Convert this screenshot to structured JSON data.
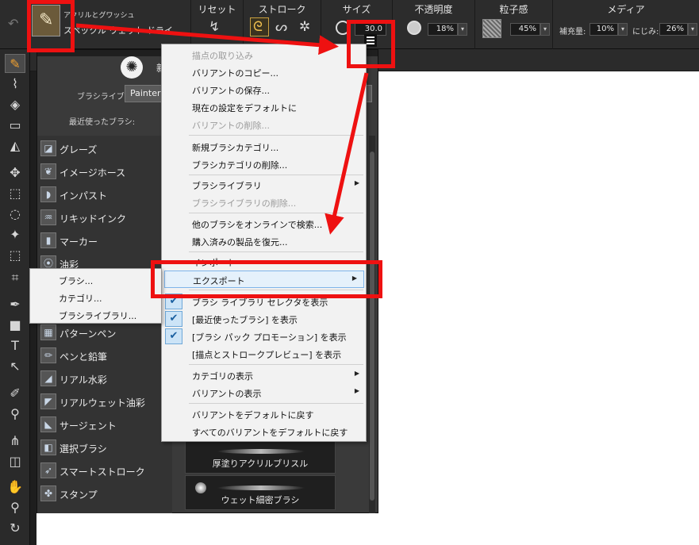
{
  "topbar": {
    "brush_category": "アクリルとグワッシュ",
    "brush_variant": "スペックル ウェット ドライ",
    "reset_label": "リセット",
    "stroke_label": "ストローク",
    "size_label": "サイズ",
    "size_value": "30.0",
    "opacity_label": "不透明度",
    "opacity_value": "18%",
    "grain_label": "粒子感",
    "grain_value": "45%",
    "media_label": "メディア",
    "resaturation_label": "補充量:",
    "resaturation_value": "10%",
    "bleed_label": "にじみ:",
    "bleed_value": "26%"
  },
  "panel": {
    "title": "新",
    "library_label": "ブラシライブラリ:",
    "library_value": "Painter",
    "recent_label": "最近使ったブラシ:",
    "categories": [
      {
        "label": "グレーズ",
        "icon": "glaze-icon"
      },
      {
        "label": "イメージホース",
        "icon": "image-hose-icon"
      },
      {
        "label": "インパスト",
        "icon": "impasto-icon"
      },
      {
        "label": "リキッドインク",
        "icon": "liquid-ink-icon"
      },
      {
        "label": "マーカー",
        "icon": "marker-icon"
      },
      {
        "label": "油彩",
        "icon": "oil-icon"
      },
      {
        "label": "",
        "icon": "blank-icon"
      },
      {
        "label": "",
        "icon": "blank-icon"
      },
      {
        "label": "パターンペン",
        "icon": "pattern-pen-icon"
      },
      {
        "label": "ペンと鉛筆",
        "icon": "pen-pencil-icon"
      },
      {
        "label": "リアル水彩",
        "icon": "real-watercolor-icon"
      },
      {
        "label": "リアルウェット油彩",
        "icon": "real-wet-oil-icon"
      },
      {
        "label": "サージェント",
        "icon": "sargent-icon"
      },
      {
        "label": "選択ブラシ",
        "icon": "selection-brush-icon"
      },
      {
        "label": "スマートストローク",
        "icon": "smart-stroke-icon"
      },
      {
        "label": "スタンプ",
        "icon": "stamp-icon"
      }
    ],
    "variants": [
      {
        "label": "厚塗りアクリルブリスル"
      },
      {
        "label": "ウェット細密ブラシ"
      }
    ]
  },
  "menu": {
    "items": [
      {
        "label": "描点の取り込み",
        "disabled": true
      },
      {
        "label": "バリアントのコピー...",
        "disabled": false
      },
      {
        "label": "バリアントの保存...",
        "disabled": false
      },
      {
        "label": "現在の設定をデフォルトに",
        "disabled": false
      },
      {
        "label": "バリアントの削除...",
        "disabled": true
      },
      {
        "label": "新規ブラシカテゴリ...",
        "disabled": false
      },
      {
        "label": "ブラシカテゴリの削除...",
        "disabled": false
      },
      {
        "label": "ブラシライブラリ",
        "disabled": false,
        "submenu": true
      },
      {
        "label": "ブラシライブラリの削除...",
        "disabled": true
      },
      {
        "label": "他のブラシをオンラインで検索...",
        "disabled": false
      },
      {
        "label": "購入済みの製品を復元...",
        "disabled": false
      },
      {
        "label": "インポート",
        "disabled": false
      },
      {
        "label": "エクスポート",
        "disabled": false,
        "submenu": true,
        "highlighted": true
      },
      {
        "label": "ブラシ ライブラリ セレクタを表示",
        "checked": true
      },
      {
        "label": "[最近使ったブラシ] を表示",
        "checked": true
      },
      {
        "label": "[ブラシ パック プロモーション] を表示",
        "checked": true
      },
      {
        "label": "[描点とストロークプレビュー] を表示",
        "checked": false
      },
      {
        "label": "カテゴリの表示",
        "submenu": true
      },
      {
        "label": "バリアントの表示",
        "submenu": true
      },
      {
        "label": "バリアントをデフォルトに戻す"
      },
      {
        "label": "すべてのバリアントをデフォルトに戻す"
      }
    ]
  },
  "submenu": {
    "items": [
      {
        "label": "ブラシ..."
      },
      {
        "label": "カテゴリ..."
      },
      {
        "label": "ブラシライブラリ..."
      }
    ]
  },
  "colors": {
    "annotation": "#ee1111",
    "highlight_border": "#7eb4ea",
    "accent": "#f0a030"
  }
}
